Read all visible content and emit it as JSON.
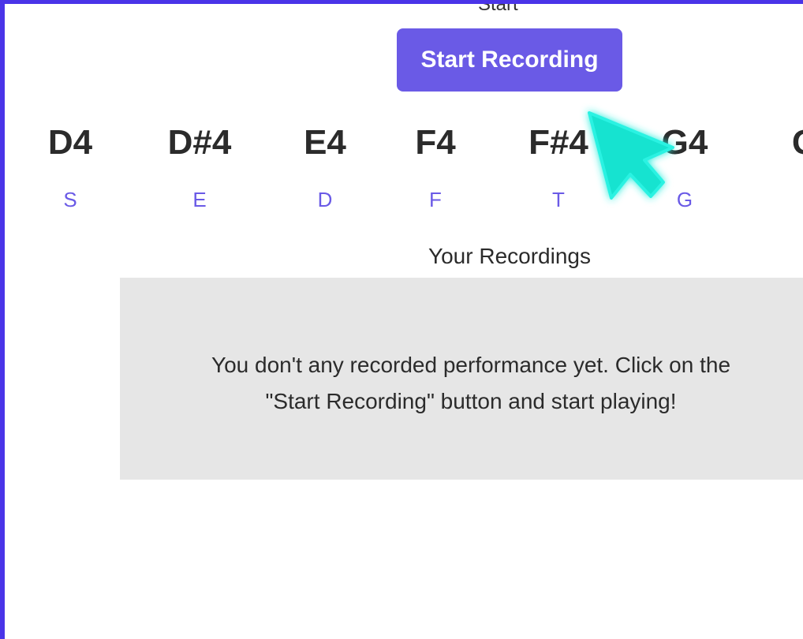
{
  "header": {
    "cut_label": "Start",
    "record_button_label": "Start Recording"
  },
  "keyboard": {
    "notes": [
      {
        "note": "D4",
        "key": "S"
      },
      {
        "note": "D#4",
        "key": "E"
      },
      {
        "note": "E4",
        "key": "D"
      },
      {
        "note": "F4",
        "key": "F"
      },
      {
        "note": "F#4",
        "key": "T"
      },
      {
        "note": "G4",
        "key": "G"
      },
      {
        "note": "G",
        "key": ""
      }
    ]
  },
  "recordings": {
    "title": "Your Recordings",
    "empty_message_line1": "You don't any recorded performance yet. Click on the",
    "empty_message_line2": "\"Start Recording\" button and start playing!"
  },
  "colors": {
    "accent": "#6a5ae6",
    "frame_border": "#4a34e8",
    "cursor": "#16e3d0",
    "panel_bg": "#e6e6e6"
  },
  "icons": {
    "cursor": "mouse-pointer-icon"
  }
}
